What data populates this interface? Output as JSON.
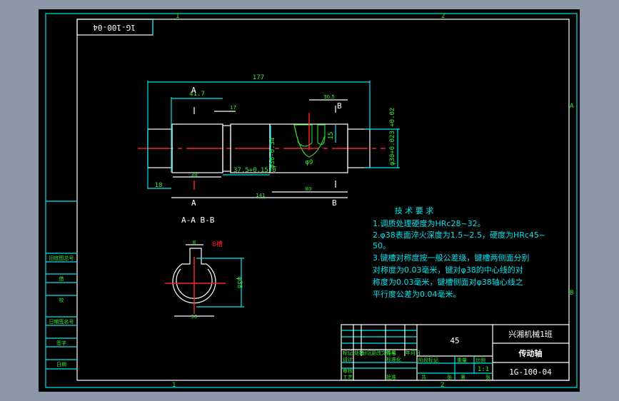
{
  "colors": {
    "background": "#8b97a8",
    "canvas": "#000000",
    "frame": "#00e5ee",
    "outline": "#ffffff",
    "centerline": "#ff2020",
    "dimension": "#33ee33"
  },
  "zones": {
    "top": [
      "1",
      "2"
    ],
    "bottom": [
      "1",
      "2"
    ],
    "right": [
      "A",
      "B"
    ]
  },
  "stamp": "1G-100-04",
  "dims": {
    "overall": "177",
    "d1": "41.7",
    "d2": "17",
    "d3": "38",
    "d4": "18",
    "d5": "37.5+0.15 0",
    "d6": "φ36-0.34",
    "d7": "30.5",
    "d8": "15",
    "d9": "φ9",
    "d10": "80",
    "d11": "141",
    "d12": "φ30+0.023 +0.02",
    "d13": "8",
    "d14": "φ38",
    "d15": "30"
  },
  "section_marks": {
    "a_top": "A",
    "a_bottom": "A",
    "b_top": "B",
    "b_bottom": "B"
  },
  "section_title": "A-A  B-B",
  "section_note": "8槽",
  "tech": {
    "title": "技 术 要 求",
    "lines": [
      "1.调质处理硬度为HRc28~32。",
      "2.φ38表面淬火深度为1.5~2.5，硬度为HRc45~",
      "50。",
      "3.键槽对称度按一般公差级，键槽两侧面分别",
      "对称度为0.03毫米，键对φ38的中心线的对",
      "称度为0.03毫米，键槽侧面对φ38轴心线之",
      "平行度公差为0.04毫米。"
    ]
  },
  "title_block": {
    "material": "45",
    "school": "兴湘机械1班",
    "part_name": "传动轴",
    "drawing_no": "1G-100-04",
    "scale": "1:1",
    "labels": [
      "标记",
      "处数",
      "分区",
      "更改文件号",
      "签名",
      "年月日",
      "设计",
      "标准化",
      "审核",
      "工艺",
      "批准",
      "阶段标记",
      "重量",
      "比例",
      "共",
      "张",
      "第",
      "张"
    ]
  },
  "left_table": [
    "旧底图总号",
    "借",
    "校",
    "日期签名号",
    "签字",
    "日期"
  ]
}
